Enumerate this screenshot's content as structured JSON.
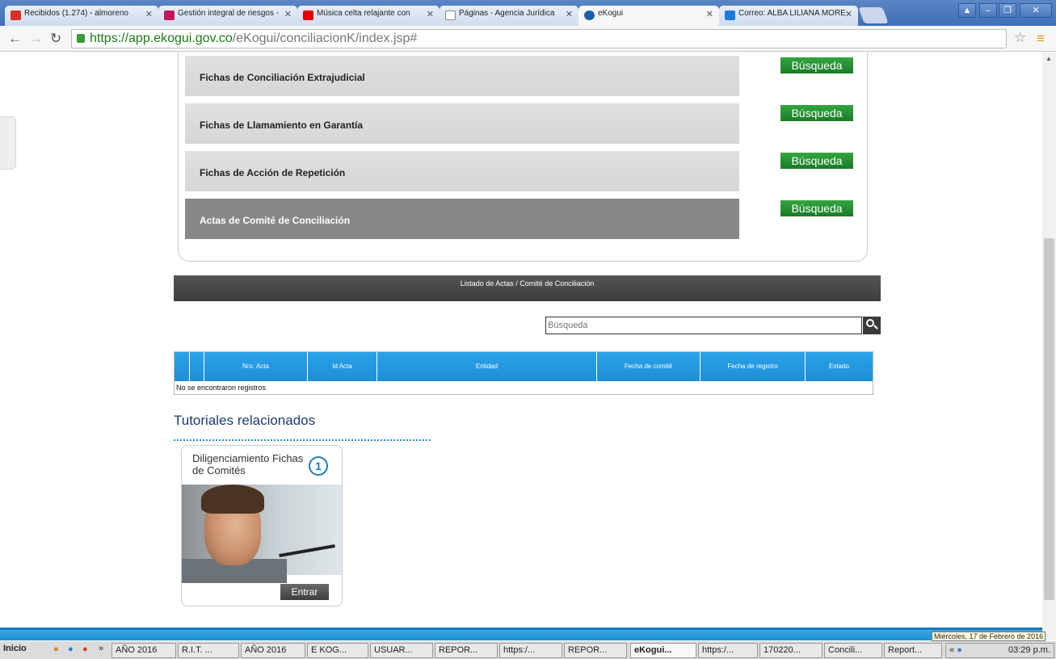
{
  "browser": {
    "tabs": [
      {
        "label": "Recibidos (1.274) - almoreno",
        "icon": "gmail-icon",
        "color": "#d93025"
      },
      {
        "label": "Gestión integral de riesgos -",
        "icon": "grid-icon",
        "color": "#c2185b"
      },
      {
        "label": "Música celta relajante con",
        "icon": "youtube-icon",
        "color": "#e00000"
      },
      {
        "label": "Páginas - Agencia Jurídica",
        "icon": "page-icon",
        "color": "#888888"
      },
      {
        "label": "eKogui",
        "icon": "ekogui-icon",
        "color": "#1b5fa8"
      },
      {
        "label": "Correo: ALBA LILIANA MORE",
        "icon": "mail-icon",
        "color": "#1e7ad8"
      }
    ],
    "url_host": "https://app.ekogui.gov.co",
    "url_path": "/eKogui/conciliacionK/index.jsp#"
  },
  "cards": [
    {
      "label": "Fichas de Conciliación Extrajudicial",
      "button": "Búsqueda"
    },
    {
      "label": "Fichas de Llamamiento en Garantía",
      "button": "Búsqueda"
    },
    {
      "label": "Fichas de Acción de Repetición",
      "button": "Búsqueda"
    },
    {
      "label": "Actas de Comité de Conciliación",
      "button": "Búsqueda"
    }
  ],
  "list_title": "Listado de Actas / Comité de Conciliación",
  "search": {
    "placeholder": "Búsqueda"
  },
  "table": {
    "columns": [
      "Nro. Acta",
      "Id Acta",
      "Entidad",
      "Fecha de comité",
      "Fecha de registro",
      "Estado"
    ],
    "empty_message": "No se encontraron registros"
  },
  "tutorials": {
    "heading": "Tutoriales relacionados",
    "items": [
      {
        "title": "Diligenciamiento Fichas de Comités",
        "number": "1",
        "button": "Entrar"
      }
    ]
  },
  "taskbar": {
    "start": "Inicio",
    "items": [
      "AÑO 2016",
      "R.I.T. ...",
      "AÑO 2016",
      "E KOG...",
      "USUAR...",
      "REPOR...",
      "https:/...",
      "REPOR...",
      "eKogui...",
      "https:/...",
      "170220...",
      "Concili...",
      "Report..."
    ],
    "clock": "03:29 p.m.",
    "tooltip": "Miércoles, 17 de Febrero de 2016"
  },
  "colors": {
    "green_button": "#1f8a2e",
    "table_header": "#1e8fd6",
    "heading": "#1b3d6b"
  }
}
